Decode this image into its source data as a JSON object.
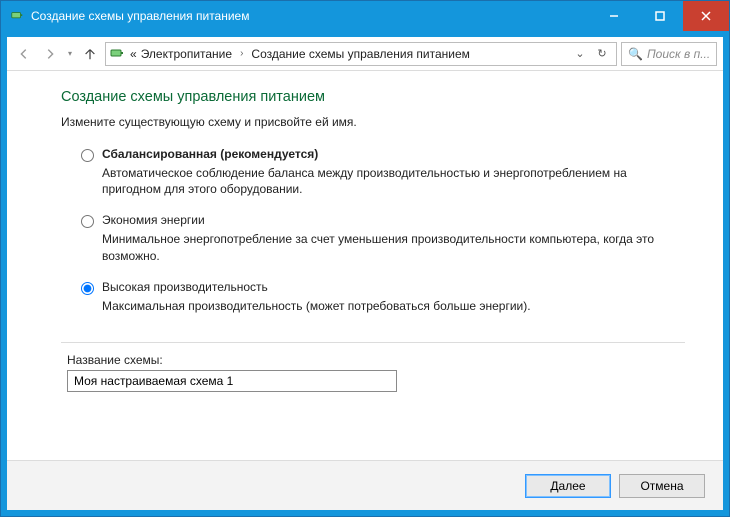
{
  "window": {
    "title": "Создание схемы управления питанием"
  },
  "breadcrumb": {
    "prefix": "«",
    "item1": "Электропитание",
    "item2": "Создание схемы управления питанием"
  },
  "search": {
    "placeholder": "Поиск в п..."
  },
  "page": {
    "heading": "Создание схемы управления питанием",
    "subheading": "Измените существующую схему и присвойте ей имя."
  },
  "plans": [
    {
      "id": "balanced",
      "title": "Сбалансированная (рекомендуется)",
      "bold": true,
      "desc": "Автоматическое соблюдение баланса между производительностью и энергопотреблением на пригодном для этого оборудовании.",
      "selected": false
    },
    {
      "id": "powersaver",
      "title": "Экономия энергии",
      "bold": false,
      "desc": "Минимальное энергопотребление за счет уменьшения производительности компьютера, когда это возможно.",
      "selected": false
    },
    {
      "id": "highperf",
      "title": "Высокая производительность",
      "bold": false,
      "desc": "Максимальная производительность (может потребоваться больше энергии).",
      "selected": true
    }
  ],
  "scheme_name": {
    "label": "Название схемы:",
    "value": "Моя настраиваемая схема 1"
  },
  "buttons": {
    "next": "Далее",
    "cancel": "Отмена"
  }
}
